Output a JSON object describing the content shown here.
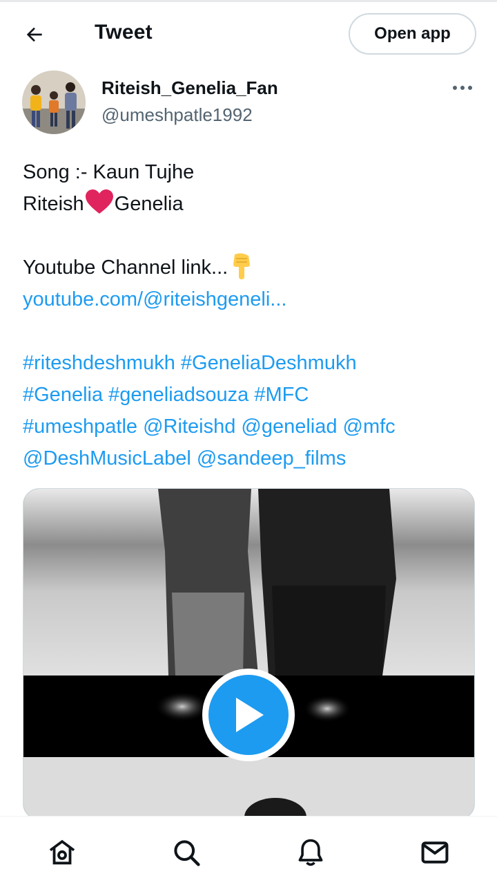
{
  "header": {
    "title": "Tweet",
    "open_app_label": "Open app"
  },
  "author": {
    "display_name": "Riteish_Genelia_Fan",
    "handle": "@umeshpatle1992"
  },
  "tweet": {
    "line1": "Song :- Kaun Tujhe",
    "line2_before": "Riteish",
    "line2_after": "Genelia",
    "line3": "Youtube Channel link...",
    "link": "youtube.com/@riteishgeneli...",
    "tags_line1": "#riteshdeshmukh #GeneliaDeshmukh",
    "tags_line2": "#Genelia #geneliadsouza #MFC",
    "tags_line3": "#umeshpatle @Riteishd @geneliad @mfc",
    "tags_line4": "@DeshMusicLabel @sandeep_films"
  },
  "icons": {
    "back": "arrow-left-icon",
    "more": "more-horizontal-icon",
    "play": "play-icon",
    "home": "home-icon",
    "search": "search-icon",
    "notifications": "bell-icon",
    "messages": "mail-icon"
  },
  "colors": {
    "accent": "#1d9bf0",
    "text": "#0f1419",
    "secondary": "#536471",
    "heart": "#e0245e"
  }
}
